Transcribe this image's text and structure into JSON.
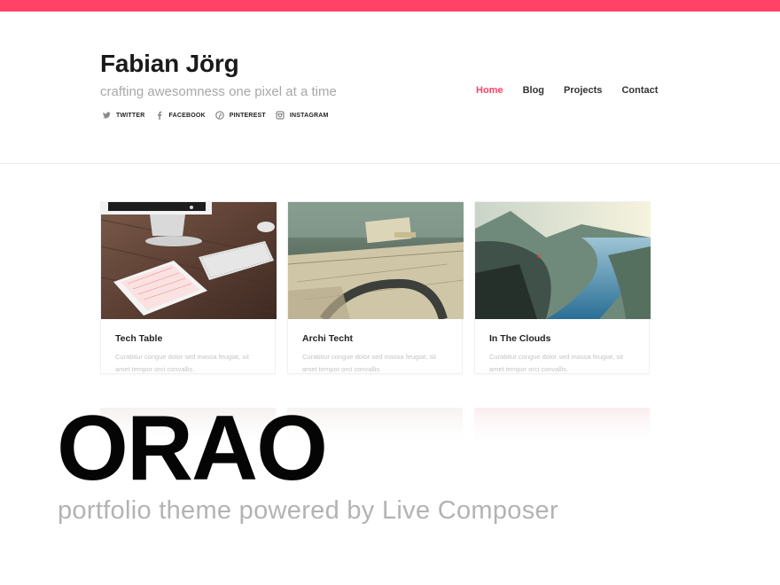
{
  "site": {
    "title": "Fabian Jörg",
    "tagline": "crafting awesomness one pixel at a time"
  },
  "social": [
    {
      "label": "TWITTER",
      "icon": "twitter-icon"
    },
    {
      "label": "FACEBOOK",
      "icon": "facebook-icon"
    },
    {
      "label": "PINTEREST",
      "icon": "pinterest-icon"
    },
    {
      "label": "INSTAGRAM",
      "icon": "instagram-icon"
    }
  ],
  "nav": [
    {
      "label": "Home",
      "active": true
    },
    {
      "label": "Blog",
      "active": false
    },
    {
      "label": "Projects",
      "active": false
    },
    {
      "label": "Contact",
      "active": false
    }
  ],
  "cards": [
    {
      "title": "Tech Table",
      "excerpt": "Curabitur congue dolor sed massa feugiat, sit amet tempor orci convallis.",
      "image": "desk-with-computer-tablet-keyboard"
    },
    {
      "title": "Archi Techt",
      "excerpt": "Curabitur congue dolor sed massa feugiat, sit amet tempor orci convallis.",
      "image": "architect-table-with-blueprints"
    },
    {
      "title": "In The Clouds",
      "excerpt": "Curabitur congue dolor sed massa feugiat, sit amet tempor orci convallis.",
      "image": "mountain-fjord-landscape"
    }
  ],
  "brand": {
    "name": "ORAO",
    "subtitle": "portfolio theme powered by Live Composer"
  },
  "colors": {
    "accent": "#ff4266",
    "text": "#222222",
    "muted": "#a8a8a8"
  }
}
